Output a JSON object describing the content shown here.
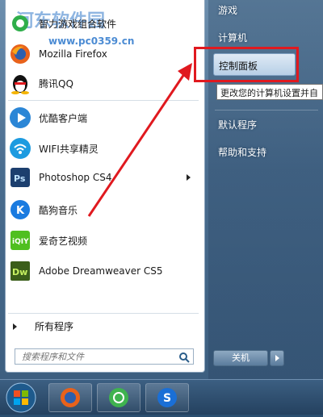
{
  "watermark": {
    "title": "河东软件园",
    "url": "www.pc0359.cn"
  },
  "programs": [
    {
      "label": "智力游戏组合软件",
      "icon": "gamepad-icon"
    },
    {
      "label": "Mozilla Firefox",
      "icon": "firefox-icon"
    },
    {
      "label": "腾讯QQ",
      "icon": "qq-icon"
    },
    {
      "label": "优酷客户端",
      "icon": "youku-icon"
    },
    {
      "label": "WIFI共享精灵",
      "icon": "wifi-icon"
    },
    {
      "label": "Photoshop CS4",
      "icon": "photoshop-icon"
    },
    {
      "label": "酷狗音乐",
      "icon": "kugou-icon"
    },
    {
      "label": "爱奇艺视频",
      "icon": "iqiyi-icon"
    },
    {
      "label": "Adobe Dreamweaver CS5",
      "icon": "dreamweaver-icon"
    }
  ],
  "all_programs": "所有程序",
  "search": {
    "placeholder": "搜索程序和文件"
  },
  "right_menu": {
    "games": "游戏",
    "computer": "计算机",
    "control_panel": "控制面板",
    "tooltip": "更改您的计算机设置并自",
    "default_programs": "默认程序",
    "help": "帮助和支持"
  },
  "shutdown": {
    "label": "关机"
  },
  "colors": {
    "highlight_box": "#e0191f",
    "annotation_arrow": "#e0191f"
  }
}
